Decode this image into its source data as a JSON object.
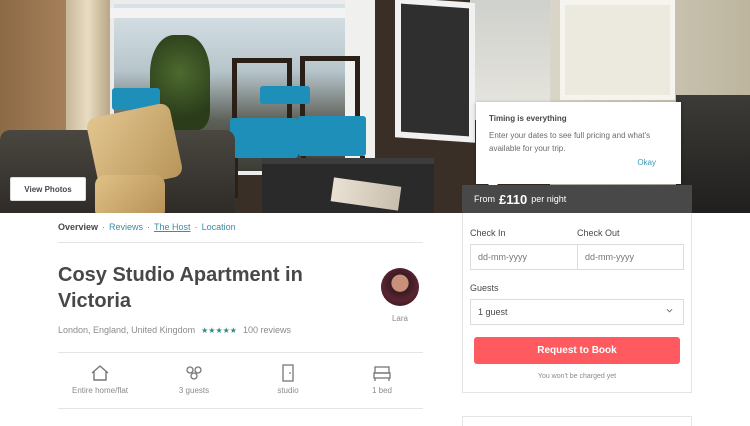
{
  "hero": {
    "view_photos_label": "View Photos"
  },
  "price": {
    "prefix": "From",
    "amount": "£110",
    "suffix": "per night"
  },
  "tooltip": {
    "title": "Timing is everything",
    "body": "Enter your dates to see full pricing and what's available for your trip.",
    "ok_label": "Okay"
  },
  "nav": {
    "overview": "Overview",
    "reviews": "Reviews",
    "host": "The Host",
    "location": "Location",
    "separator": "·"
  },
  "listing": {
    "title": "Cosy Studio Apartment in Victoria",
    "location": "London, England, United Kingdom",
    "rating_stars": "★★★★★",
    "reviews": "100 reviews",
    "host_name": "Lara"
  },
  "amenities": [
    {
      "label": "Entire home/flat",
      "icon": "house-icon"
    },
    {
      "label": "3 guests",
      "icon": "guests-icon"
    },
    {
      "label": "studio",
      "icon": "door-icon"
    },
    {
      "label": "1 bed",
      "icon": "bed-icon"
    }
  ],
  "booking": {
    "check_in_label": "Check In",
    "check_out_label": "Check Out",
    "check_in_placeholder": "dd-mm-yyyy",
    "check_out_placeholder": "dd-mm-yyyy",
    "guests_label": "Guests",
    "guests_value": "1 guest",
    "book_button": "Request to Book",
    "note": "You won't be charged yet"
  },
  "colors": {
    "accent": "#ff5a5f",
    "link": "#3d8ca3",
    "rating": "#2f8a8a",
    "price_bar": "#484848"
  }
}
